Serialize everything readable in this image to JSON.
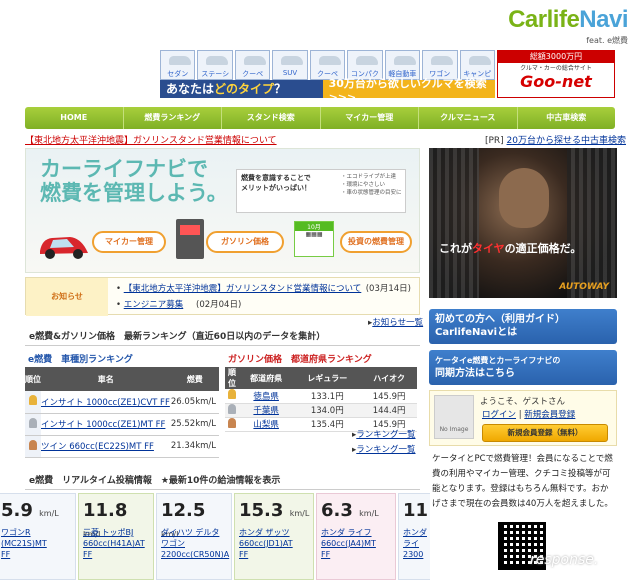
{
  "header": {
    "logo_main": "Carlife",
    "logo_accent": "Navi",
    "logo_feat": "feat. e燃費",
    "type_cards": [
      "セダン",
      "ステーションワゴン",
      "クーペ",
      "SUV",
      "クーペ",
      "コンパクトカー",
      "軽自動車",
      "ワゴン",
      "キャンピング"
    ],
    "type_question_pre": "あなたは",
    "type_question_em": "どのタイプ",
    "type_question_post": "？",
    "type_cta": "30万台から欲しいクルマを検索>>>",
    "goonet_top": "総額3000万円",
    "goonet_mid": "クルマ・カーの総合サイト",
    "goonet_brand": "Goo-net"
  },
  "nav": [
    "HOME",
    "燃費ランキング",
    "スタンド検索",
    "マイカー管理",
    "クルマニュース",
    "中古車検索"
  ],
  "top_notice": "【東北地方太平洋沖地震】ガソリンスタンド営業情報について",
  "pr": {
    "tag": "[PR]",
    "link": "20万台から探せる中古車検索"
  },
  "hero": {
    "title_line1": "カーライフナビで",
    "title_line2": "燃費を管理しよう。",
    "lead": "燃費を意識することで\nメリットがいっぱい！",
    "bullets": [
      "・エコドライブが上達",
      "・環境にやさしい",
      "・車の状態管理の目安に"
    ],
    "buttons": [
      "マイカー管理",
      "ガソリン価格",
      "投資の燃費管理"
    ],
    "cal_label": "10月",
    "tire_copy_pre": "これが",
    "tire_copy_em": "タイヤ",
    "tire_copy_post": "の適正価格だ。",
    "tire_brand": "AUTOWAY"
  },
  "oshirase": {
    "label": "お知らせ",
    "items": [
      {
        "text": "【東北地方太平洋沖地震】ガソリンスタンド営業情報について",
        "date": "(03月14日)"
      },
      {
        "text": "エンジニア募集",
        "date": "(02月04日)"
      }
    ],
    "more": "お知らせ一覧"
  },
  "ranking": {
    "heading": "e燃費&ガソリン価格　最新ランキング（直近60日以内のデータを集計）",
    "car_section": "e燃費　車種別ランキング",
    "car_headers": [
      "順位",
      "車名",
      "燃費"
    ],
    "cars": [
      {
        "name": "インサイト 1000cc(ZE1)CVT FF",
        "fuel": "26.05km/L"
      },
      {
        "name": "インサイト 1000cc(ZE1)MT FF",
        "fuel": "25.52km/L"
      },
      {
        "name": "ツイン 660cc(EC22S)MT FF",
        "fuel": "21.34km/L"
      }
    ],
    "gas_section": "ガソリン価格　都道府県ランキング",
    "gas_headers": [
      "順位",
      "都道府県",
      "レギュラー",
      "ハイオク"
    ],
    "gas": [
      {
        "pref": "徳島県",
        "regular": "133.1円",
        "high": "145.9円"
      },
      {
        "pref": "千葉県",
        "regular": "134.0円",
        "high": "144.4円"
      },
      {
        "pref": "山梨県",
        "regular": "135.4円",
        "high": "145.9円"
      }
    ],
    "more_label": "ランキング一覧"
  },
  "realtime": {
    "heading": "e燃費　リアルタイム投稿情報　★最新10件の給油情報を表示",
    "unit": "km/L",
    "cards": [
      {
        "value": "5.9",
        "name": "ワゴンR\n(MC21S)MT\nFF"
      },
      {
        "value": "11.8",
        "name": "三菱 トッポBJ\n660cc(H41A)AT\nFF"
      },
      {
        "value": "12.5",
        "name": "ダイハツ デルタ\nワゴン\n2200cc(CR50N)A"
      },
      {
        "value": "15.3",
        "name": "ホンダ ザッツ\n660cc(JD1)AT\nFF"
      },
      {
        "value": "6.3",
        "name": "ホンダ ライフ\n660cc(JA4)MT\nFF"
      },
      {
        "value": "11",
        "name": "ホンダ\nライ\n2300"
      }
    ]
  },
  "sidebar": {
    "guide_line1": "初めての方へ（利用ガイド）",
    "guide_line2": "CarlifeNaviとは",
    "sync_line1": "ケータイe燃費とカーライフナビの",
    "sync_line2": "同期方法はこちら",
    "noimage": "No Image",
    "welcome": "ようこそ、ゲストさん",
    "login": "ログイン",
    "register_link": "新規会員登録",
    "register_btn": "新規会員登録（無料）",
    "promo": "ケータイとPCで燃費管理！会員になることで燃費の利用やマイカー管理、クチコミ投稿等が可能となります。登録はもちろん無料です。おかげさまで現在の会員数は40万人を超えました。",
    "watermark": "response."
  }
}
